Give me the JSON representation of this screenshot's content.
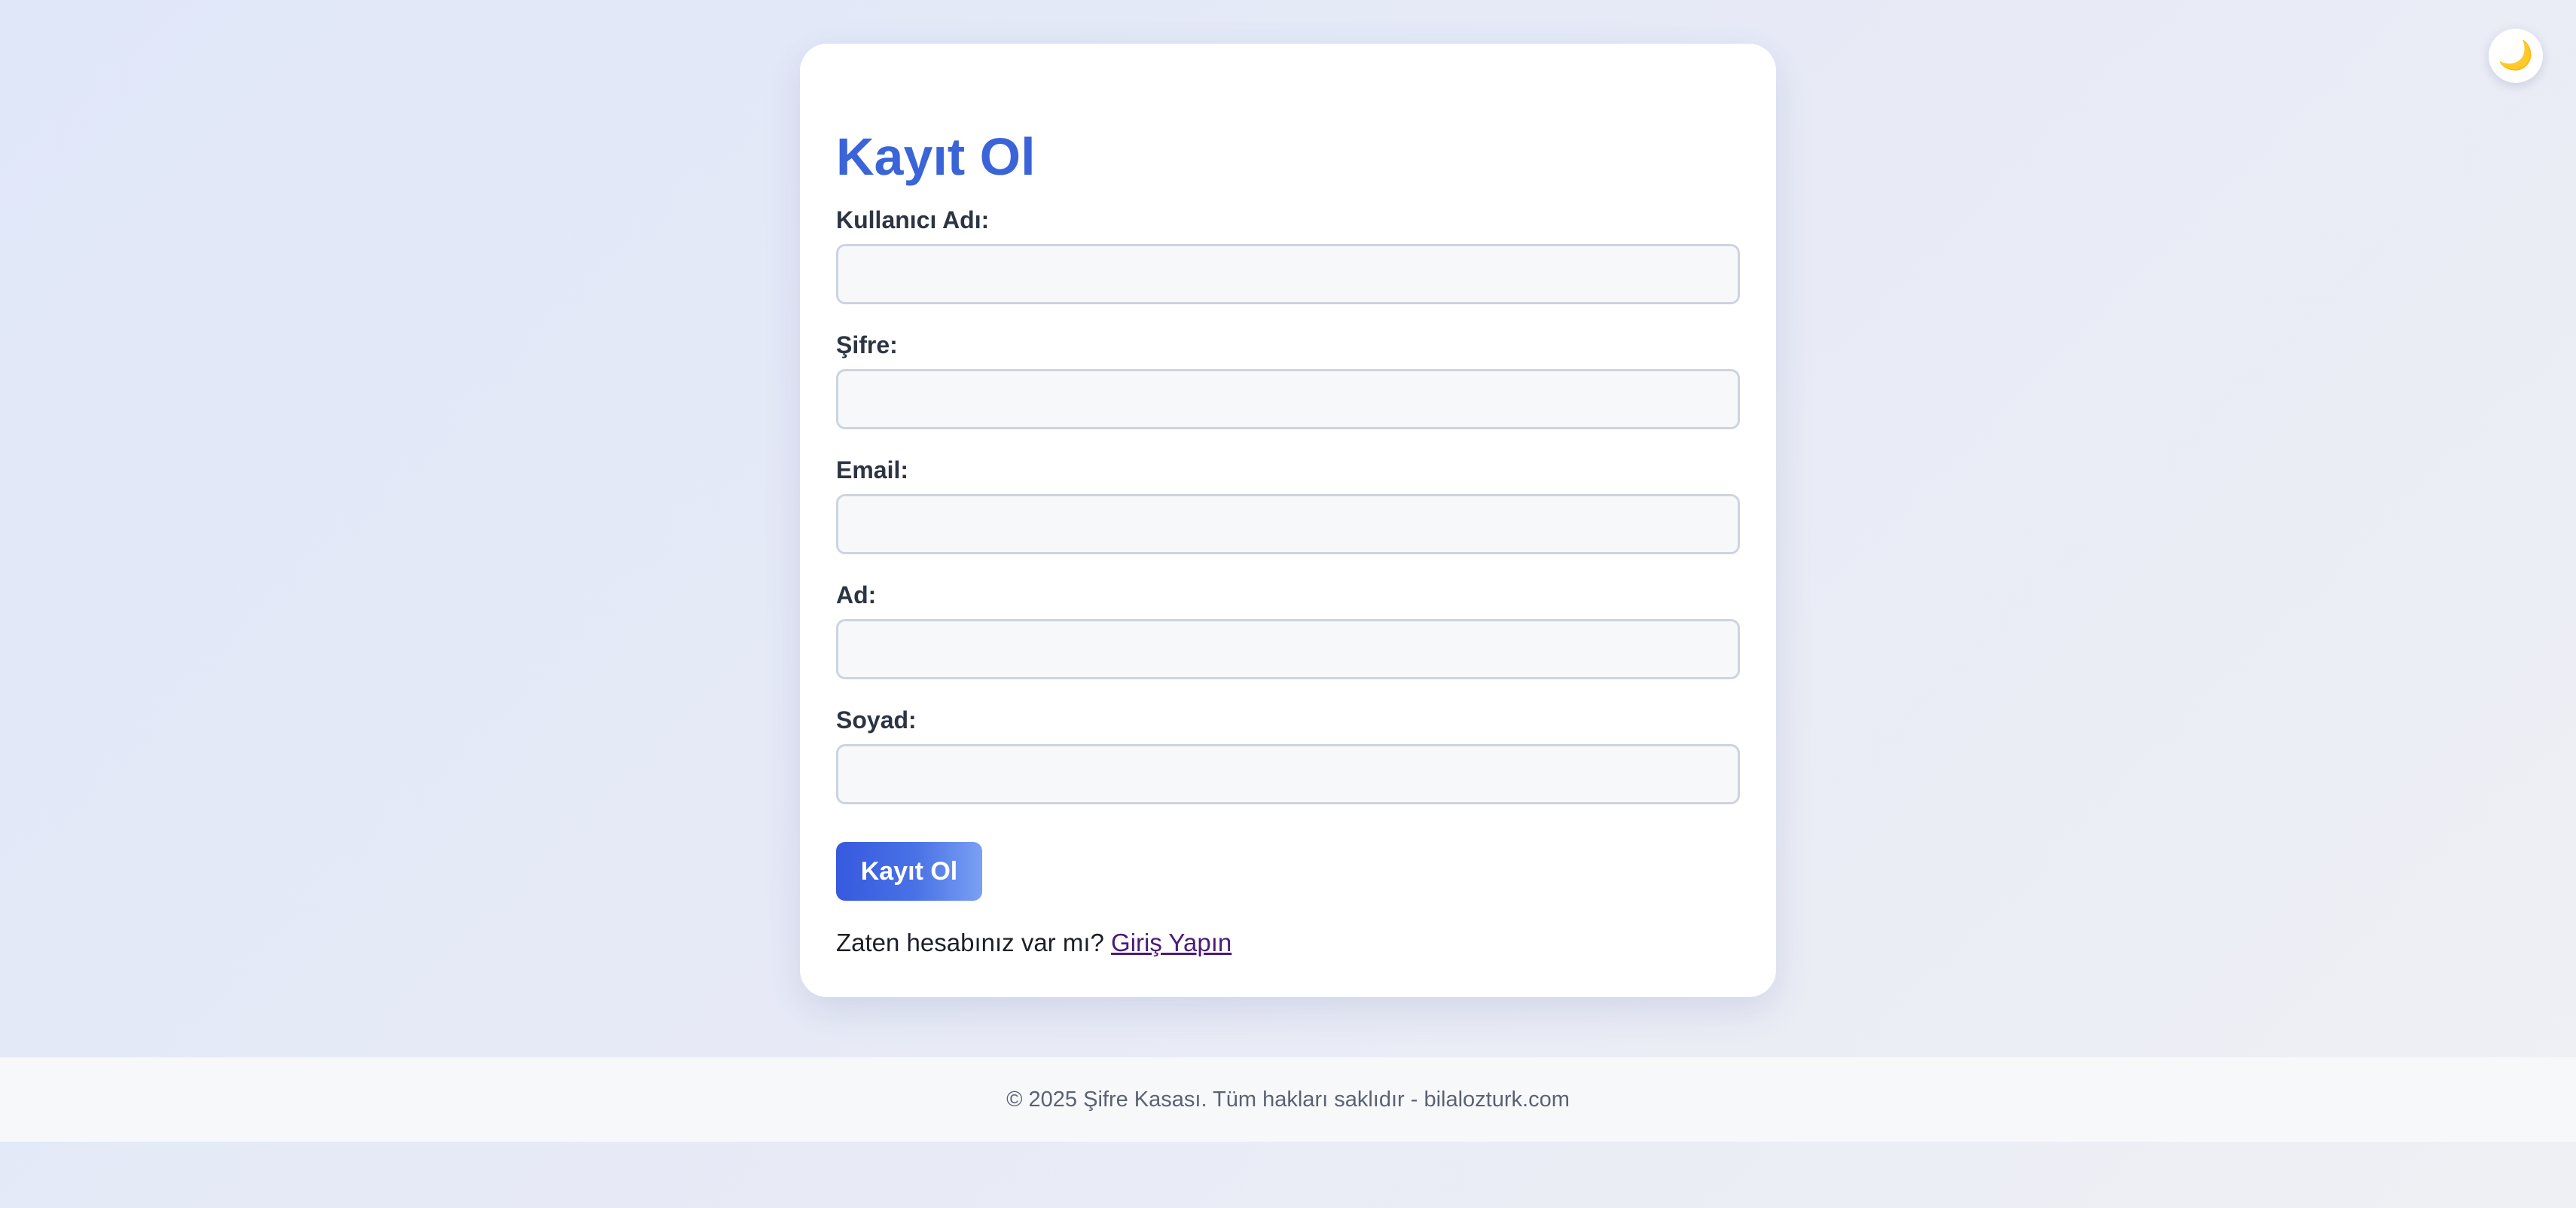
{
  "theme_toggle": {
    "icon": "moon-icon",
    "glyph": "🌙"
  },
  "form": {
    "title": "Kayıt Ol",
    "fields": [
      {
        "label": "Kullanıcı Adı:",
        "value": "",
        "placeholder": ""
      },
      {
        "label": "Şifre:",
        "value": "",
        "placeholder": ""
      },
      {
        "label": "Email:",
        "value": "",
        "placeholder": ""
      },
      {
        "label": "Ad:",
        "value": "",
        "placeholder": ""
      },
      {
        "label": "Soyad:",
        "value": "",
        "placeholder": ""
      }
    ],
    "submit_label": "Kayıt Ol",
    "login_prompt": "Zaten hesabınız var mı?",
    "login_link": "Giriş Yapın"
  },
  "footer": {
    "text": "© 2025 Şifre Kasası. Tüm hakları saklıdır - bilalozturk.com"
  },
  "colors": {
    "accent": "#3a64d8",
    "button_start": "#3659de",
    "button_end": "#7aa0f4",
    "link": "#4b1b78",
    "background": "#e0e7f9"
  }
}
